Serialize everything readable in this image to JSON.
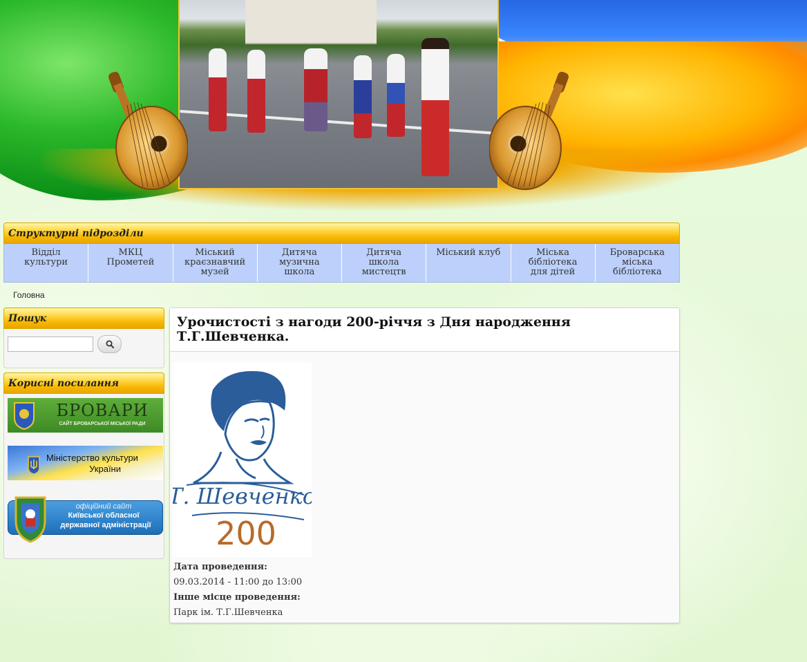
{
  "menu": {
    "title": "Структурні підрозділи",
    "items": [
      {
        "line1": "Відділ",
        "line2": "культури",
        "line3": ""
      },
      {
        "line1": "МКЦ",
        "line2": "Прометей",
        "line3": ""
      },
      {
        "line1": "Міський",
        "line2": "краєзнавчий",
        "line3": "музей"
      },
      {
        "line1": "Дитяча",
        "line2": "музична",
        "line3": "школа"
      },
      {
        "line1": "Дитяча",
        "line2": "школа",
        "line3": "мистецтв"
      },
      {
        "line1": "Міський клуб",
        "line2": "",
        "line3": ""
      },
      {
        "line1": "Міська",
        "line2": "бібліотека",
        "line3": "для дітей"
      },
      {
        "line1": "Броварська",
        "line2": "міська",
        "line3": "бібліотека"
      }
    ]
  },
  "breadcrumb": "Головна",
  "search": {
    "title": "Пошук",
    "value": "",
    "button_icon": "search-icon"
  },
  "links": {
    "title": "Корисні посилання",
    "brovary": {
      "title": "БРОВАРИ",
      "subtitle": "САЙТ БРОВАРСЬКОЇ МІСЬКОЇ РАДИ"
    },
    "ministry": {
      "line1": "Міністерство культури",
      "line2": "України"
    },
    "oda": {
      "line1": "офіційний сайт",
      "line2": "Київської обласної",
      "line3": "державної адміністрації"
    }
  },
  "article": {
    "title_line1": "Урочистості з нагоди 200-річчя з Дня народження",
    "title_line2": "Т.Г.Шевченка.",
    "poster": {
      "signature": "Т. Шевченко",
      "number": "200"
    },
    "date_label": "Дата проведення:",
    "date_value": "09.03.2014 - 11:00 до 13:00",
    "place_label": "Інше місце проведення:",
    "place_value": "Парк ім. Т.Г.Шевченка"
  },
  "colors": {
    "menu_bar": "#f7b700",
    "menu_item_bg": "#bcd0fb",
    "page_bg": "#e6f8d6",
    "poster_blue": "#2a5d9a",
    "poster_brown": "#b86a2a"
  }
}
